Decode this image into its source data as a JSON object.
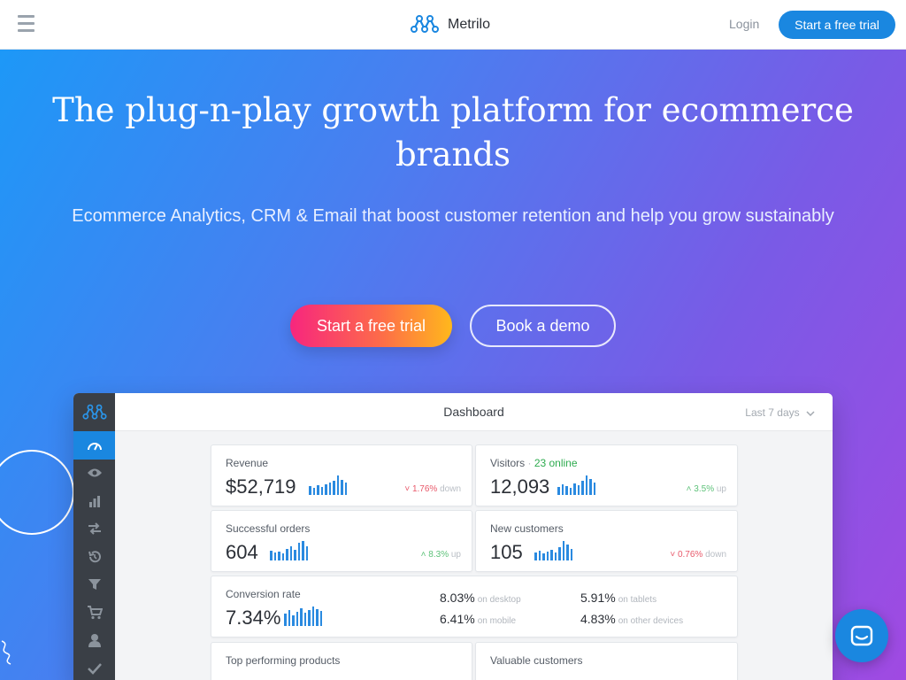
{
  "nav": {
    "brand": "Metrilo",
    "login": "Login",
    "cta": "Start a free trial"
  },
  "hero": {
    "title": "The plug-n-play growth platform for ecommerce brands",
    "subtitle": "Ecommerce Analytics, CRM & Email that boost customer retention and help you grow sustainably",
    "primary_cta": "Start a free trial",
    "secondary_cta": "Book a demo"
  },
  "dashboard": {
    "title": "Dashboard",
    "range": "Last 7 days",
    "sidebar_icons": [
      "speedometer-icon",
      "eye-icon",
      "bar-chart-icon",
      "transfer-icon",
      "history-icon",
      "funnel-icon",
      "cart-icon",
      "user-icon",
      "check-icon"
    ],
    "revenue": {
      "label": "Revenue",
      "value": "$52,719",
      "delta": "1.76%",
      "delta_word": "down",
      "trend": "down"
    },
    "visitors": {
      "label": "Visitors",
      "online": "23 online",
      "value": "12,093",
      "delta": "3.5%",
      "delta_word": "up",
      "trend": "up"
    },
    "orders": {
      "label": "Successful orders",
      "value": "604",
      "delta": "8.3%",
      "delta_word": "up",
      "trend": "up"
    },
    "customers": {
      "label": "New customers",
      "value": "105",
      "delta": "0.76%",
      "delta_word": "down",
      "trend": "down"
    },
    "conversion": {
      "label": "Conversion rate",
      "value": "7.34%",
      "desktop": {
        "value": "8.03%",
        "label": "on desktop"
      },
      "mobile": {
        "value": "6.41%",
        "label": "on mobile"
      },
      "tablets": {
        "value": "5.91%",
        "label": "on tablets"
      },
      "other": {
        "value": "4.83%",
        "label": "on other devices"
      }
    },
    "top_products_label": "Top performing products",
    "valuable_customers_label": "Valuable customers"
  },
  "colors": {
    "accent": "#1a87e0",
    "down": "#e8596a",
    "up": "#5ec27a",
    "online": "#2eab4f"
  },
  "chat": {
    "icon": "chat-icon"
  }
}
